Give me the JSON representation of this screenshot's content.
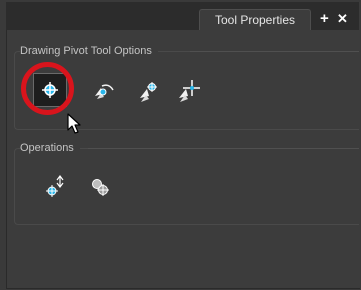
{
  "panel": {
    "tab_title": "Tool Properties",
    "add_symbol": "+",
    "close_symbol": "✕"
  },
  "pivot_options": {
    "title": "Drawing Pivot Tool Options",
    "buttons": [
      {
        "icon": "set-on-frame-pivot-icon",
        "selected": true
      },
      {
        "icon": "rotate-pivot-icon",
        "selected": false
      },
      {
        "icon": "move-pivot-icon",
        "selected": false
      },
      {
        "icon": "offset-pivot-icon",
        "selected": false
      }
    ]
  },
  "operations": {
    "title": "Operations",
    "buttons": [
      {
        "icon": "apply-pivot-icon"
      },
      {
        "icon": "reset-pivot-icon"
      }
    ]
  },
  "colors": {
    "highlight_ring": "#d9141c",
    "icon_cyan": "#29b6ea",
    "background": "#3c3c3c"
  }
}
